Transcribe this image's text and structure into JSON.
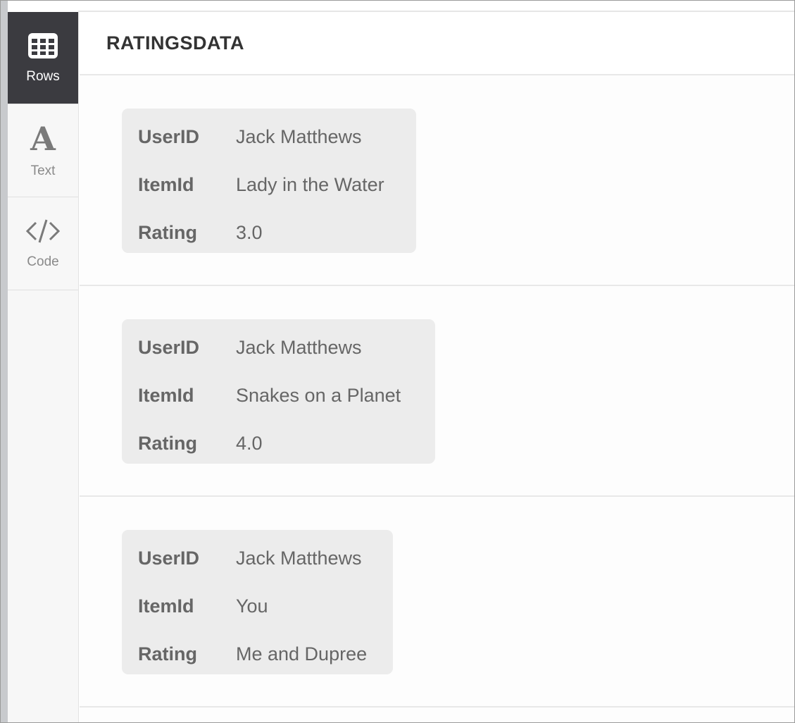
{
  "sidebar": {
    "items": [
      {
        "label": "Rows",
        "icon": "table-grid-icon",
        "active": true
      },
      {
        "label": "Text",
        "icon": "letter-a-icon",
        "active": false
      },
      {
        "label": "Code",
        "icon": "code-brackets-icon",
        "active": false
      }
    ]
  },
  "header": {
    "title": "RATINGSDATA"
  },
  "rows": [
    {
      "fields": [
        {
          "key": "UserID",
          "value": "Jack Matthews"
        },
        {
          "key": "ItemId",
          "value": "Lady in the Water"
        },
        {
          "key": "Rating",
          "value": "3.0"
        }
      ]
    },
    {
      "fields": [
        {
          "key": "UserID",
          "value": "Jack Matthews"
        },
        {
          "key": "ItemId",
          "value": "Snakes on a Planet"
        },
        {
          "key": "Rating",
          "value": "4.0"
        }
      ]
    },
    {
      "fields": [
        {
          "key": "UserID",
          "value": "Jack Matthews"
        },
        {
          "key": "ItemId",
          "value": "You"
        },
        {
          "key": "Rating",
          "value": "Me and Dupree"
        }
      ]
    }
  ],
  "colors": {
    "sidebar_active_bg": "#3b3b40",
    "card_bg": "#ececec",
    "text_gray": "#666666"
  }
}
